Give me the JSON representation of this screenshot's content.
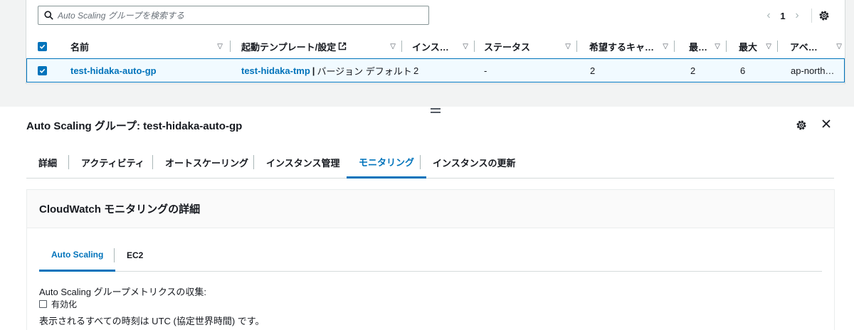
{
  "search": {
    "placeholder": "Auto Scaling グループを検索する"
  },
  "pagination": {
    "current_page": "1"
  },
  "table": {
    "columns": [
      {
        "key": "name",
        "label": "名前"
      },
      {
        "key": "template",
        "label": "起動テンプレート/設定"
      },
      {
        "key": "instances",
        "label": "インス…"
      },
      {
        "key": "status",
        "label": "ステータス"
      },
      {
        "key": "desired",
        "label": "希望するキャ…"
      },
      {
        "key": "min",
        "label": "最…"
      },
      {
        "key": "max",
        "label": "最大"
      },
      {
        "key": "az",
        "label": "アベ…"
      }
    ],
    "rows": [
      {
        "selected": true,
        "name": "test-hidaka-auto-gp",
        "template_link": "test-hidaka-tmp",
        "template_sep": "|",
        "template_version": "バージョン デフォルト",
        "instances": "2",
        "status": "-",
        "desired": "2",
        "min": "2",
        "max": "6",
        "az": "ap-north…"
      }
    ]
  },
  "details": {
    "title": "Auto Scaling グループ: test-hidaka-auto-gp",
    "tabs": [
      {
        "label": "詳細",
        "active": false
      },
      {
        "label": "アクティビティ",
        "active": false
      },
      {
        "label": "オートスケーリング",
        "active": false
      },
      {
        "label": "インスタンス管理",
        "active": false
      },
      {
        "label": "モニタリング",
        "active": true
      },
      {
        "label": "インスタンスの更新",
        "active": false
      }
    ]
  },
  "cloudwatch": {
    "header": "CloudWatch モニタリングの詳細",
    "subtabs": [
      {
        "label": "Auto Scaling",
        "active": true
      },
      {
        "label": "EC2",
        "active": false
      }
    ],
    "metrics_label": "Auto Scaling グループメトリクスの収集:",
    "enable_label": "有効化",
    "enabled": false,
    "time_note": "表示されるすべての時刻は UTC (協定世界時間) です。"
  },
  "colors": {
    "accent": "#0073bb",
    "selected_row_bg": "#f1faff",
    "page_bg": "#f2f3f3"
  },
  "icons": [
    "search-icon",
    "chevron-left-icon",
    "chevron-right-icon",
    "gear-icon",
    "external-link-icon",
    "sort-icon",
    "close-icon",
    "drag-handle-icon",
    "checkbox-icon"
  ]
}
